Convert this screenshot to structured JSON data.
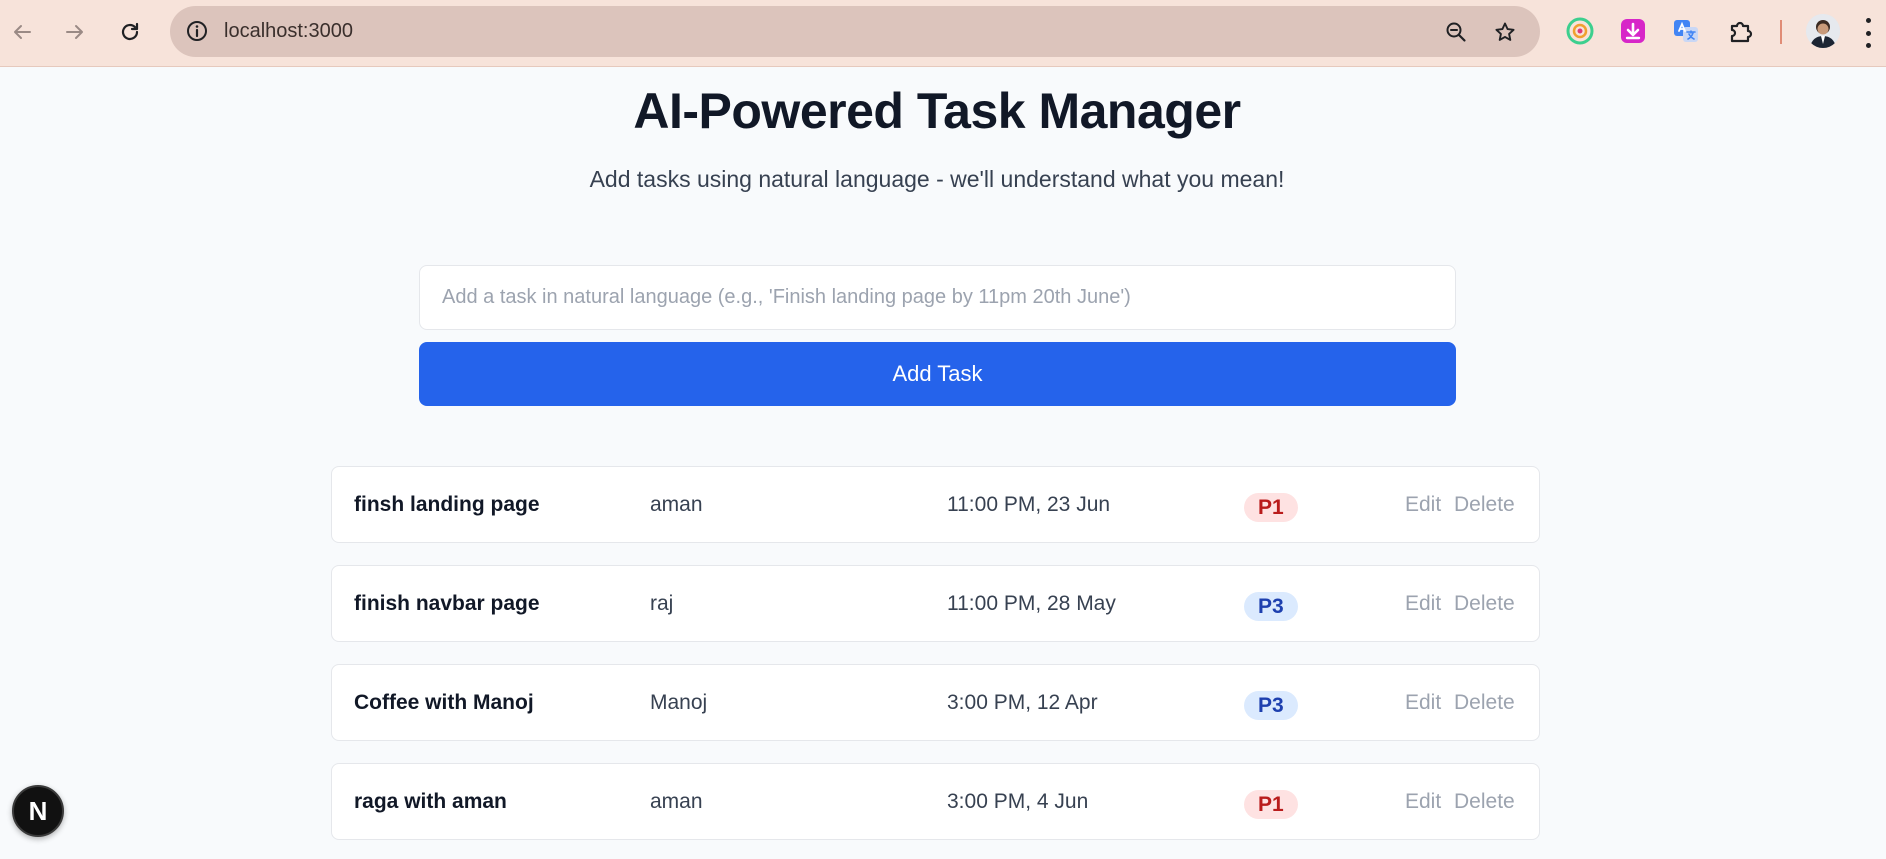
{
  "browser": {
    "url": "localhost:3000",
    "icons": {
      "back": "back-arrow-icon",
      "forward": "forward-arrow-icon",
      "reload": "reload-icon",
      "info": "info-icon",
      "zoom": "zoom-icon",
      "bookmark": "star-icon",
      "extensions": [
        "grammarly-icon",
        "download-extension-icon",
        "translate-icon",
        "puzzle-icon"
      ],
      "menu": "kebab-menu-icon"
    }
  },
  "page": {
    "title": "AI-Powered Task Manager",
    "subtitle": "Add tasks using natural language - we'll understand what you mean!"
  },
  "form": {
    "input_value": "",
    "input_placeholder": "Add a task in natural language (e.g., 'Finish landing page by 11pm 20th June')",
    "add_button_label": "Add Task"
  },
  "tasks": [
    {
      "title": "finsh landing page",
      "assignee": "aman",
      "due": "11:00 PM, 23 Jun",
      "priority": "P1",
      "edit_label": "Edit",
      "delete_label": "Delete"
    },
    {
      "title": "finish navbar page",
      "assignee": "raj",
      "due": "11:00 PM, 28 May",
      "priority": "P3",
      "edit_label": "Edit",
      "delete_label": "Delete"
    },
    {
      "title": "Coffee with Manoj",
      "assignee": "Manoj",
      "due": "3:00 PM, 12 Apr",
      "priority": "P3",
      "edit_label": "Edit",
      "delete_label": "Delete"
    },
    {
      "title": "raga with aman",
      "assignee": "aman",
      "due": "3:00 PM, 4 Jun",
      "priority": "P1",
      "edit_label": "Edit",
      "delete_label": "Delete"
    }
  ],
  "dev_badge": {
    "letter": "N"
  },
  "colors": {
    "primary": "#2563eb",
    "p1_bg": "#fee2e2",
    "p1_text": "#b91c1c",
    "p3_bg": "#dbeafe",
    "p3_text": "#1e40af"
  }
}
